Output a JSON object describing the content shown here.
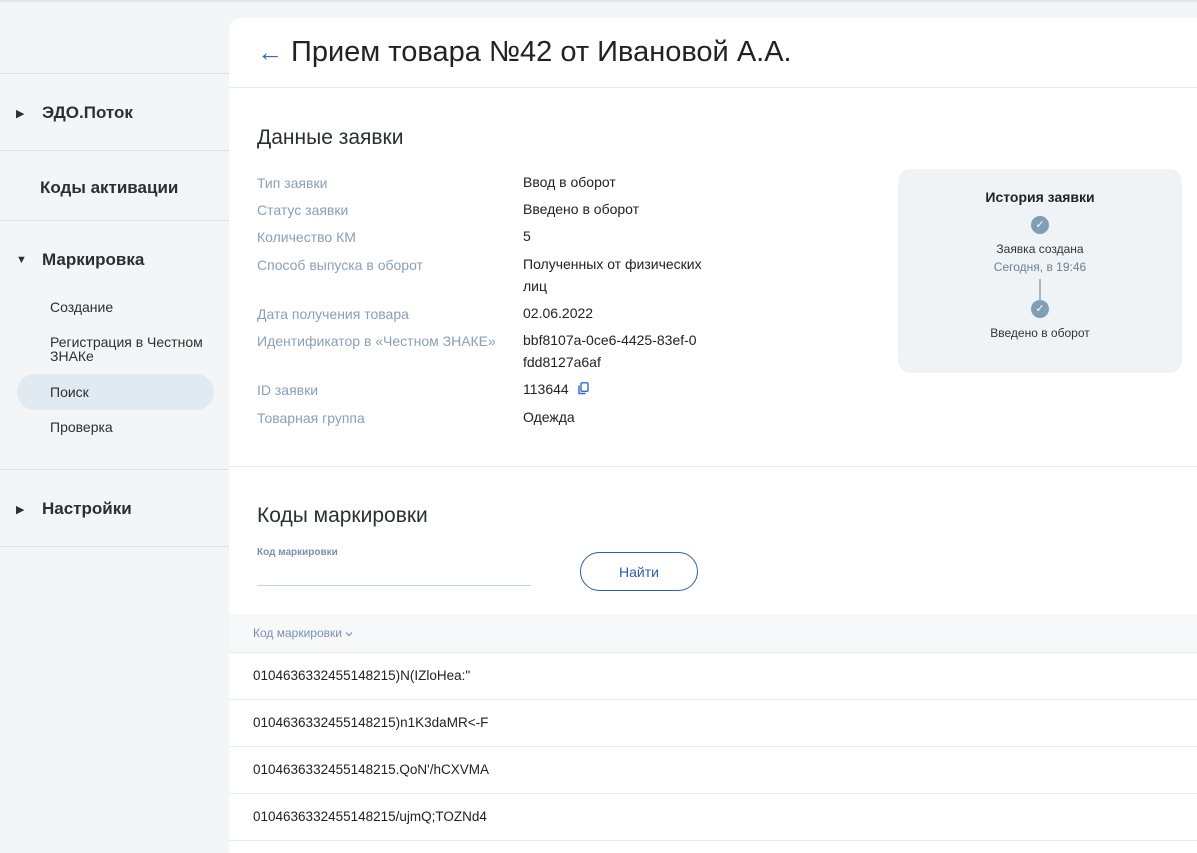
{
  "sidebar": {
    "sections": [
      {
        "label": "ЭДО.Поток",
        "caret": "▶"
      },
      {
        "label": "Коды активации"
      },
      {
        "label": "Маркировка",
        "caret": "▼"
      },
      {
        "label": "Настройки",
        "caret": "▶"
      }
    ],
    "items": [
      {
        "label": "Создание"
      },
      {
        "label": "Регистрация в Честном ЗНАКе"
      },
      {
        "label": "Поиск",
        "active": true
      },
      {
        "label": "Проверка"
      }
    ]
  },
  "header": {
    "back_arrow": "←",
    "title": "Прием товара №42 от Ивановой А.А."
  },
  "details": {
    "section_title": "Данные заявки",
    "fields": [
      {
        "label": "Тип заявки",
        "value": "Ввод в оборот"
      },
      {
        "label": "Статус заявки",
        "value": "Введено в оборот"
      },
      {
        "label": "Количество КМ",
        "value": "5"
      },
      {
        "label": "Способ выпуска в оборот",
        "value": "Полученных от физических лиц"
      },
      {
        "label": "Дата получения товара",
        "value": "02.06.2022"
      },
      {
        "label": "Идентификатор в «Честном ЗНАКЕ»",
        "value": "bbf8107a-0ce6-4425-83ef-0fdd8127a6af"
      },
      {
        "label": "ID заявки",
        "value": "113644"
      },
      {
        "label": "Товарная группа",
        "value": "Одежда"
      }
    ]
  },
  "history": {
    "title": "История заявки",
    "steps": [
      {
        "label": "Заявка создана",
        "sub": "Сегодня, в 19:46",
        "icon": "check-icon"
      },
      {
        "label": "Введено в оборот",
        "sub": "",
        "icon": "check-icon"
      }
    ]
  },
  "codes": {
    "section_title": "Коды маркировки",
    "search_label": "Код маркировки",
    "search_value": "",
    "find_button": "Найти",
    "column_header": "Код маркировки",
    "sort_icon": "chevron-down-icon",
    "rows": [
      "0104636332455148215)N(IZloHea:\"",
      "0104636332455148215)n1K3daMR<-F",
      "0104636332455148215.QoN'/hCXVMA",
      "0104636332455148215/ujmQ;TOZNd4"
    ]
  },
  "colors": {
    "accent": "#2f6ccf",
    "label": "#8aa0b6",
    "active_bg": "#e1e9f1"
  }
}
